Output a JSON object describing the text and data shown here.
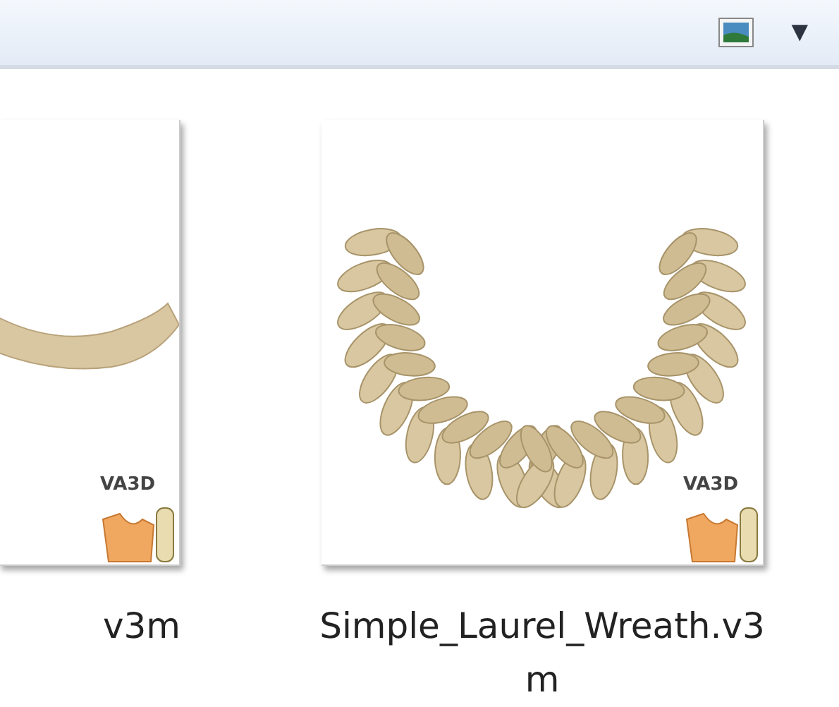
{
  "toolbar": {
    "view_menu": "▼"
  },
  "files": [
    {
      "kind": "partial",
      "name": "v3m",
      "badge": "VA3D"
    },
    {
      "kind": "wreath",
      "name": "Simple_Laurel_Wreath.v3\nm",
      "badge": "VA3D"
    }
  ]
}
